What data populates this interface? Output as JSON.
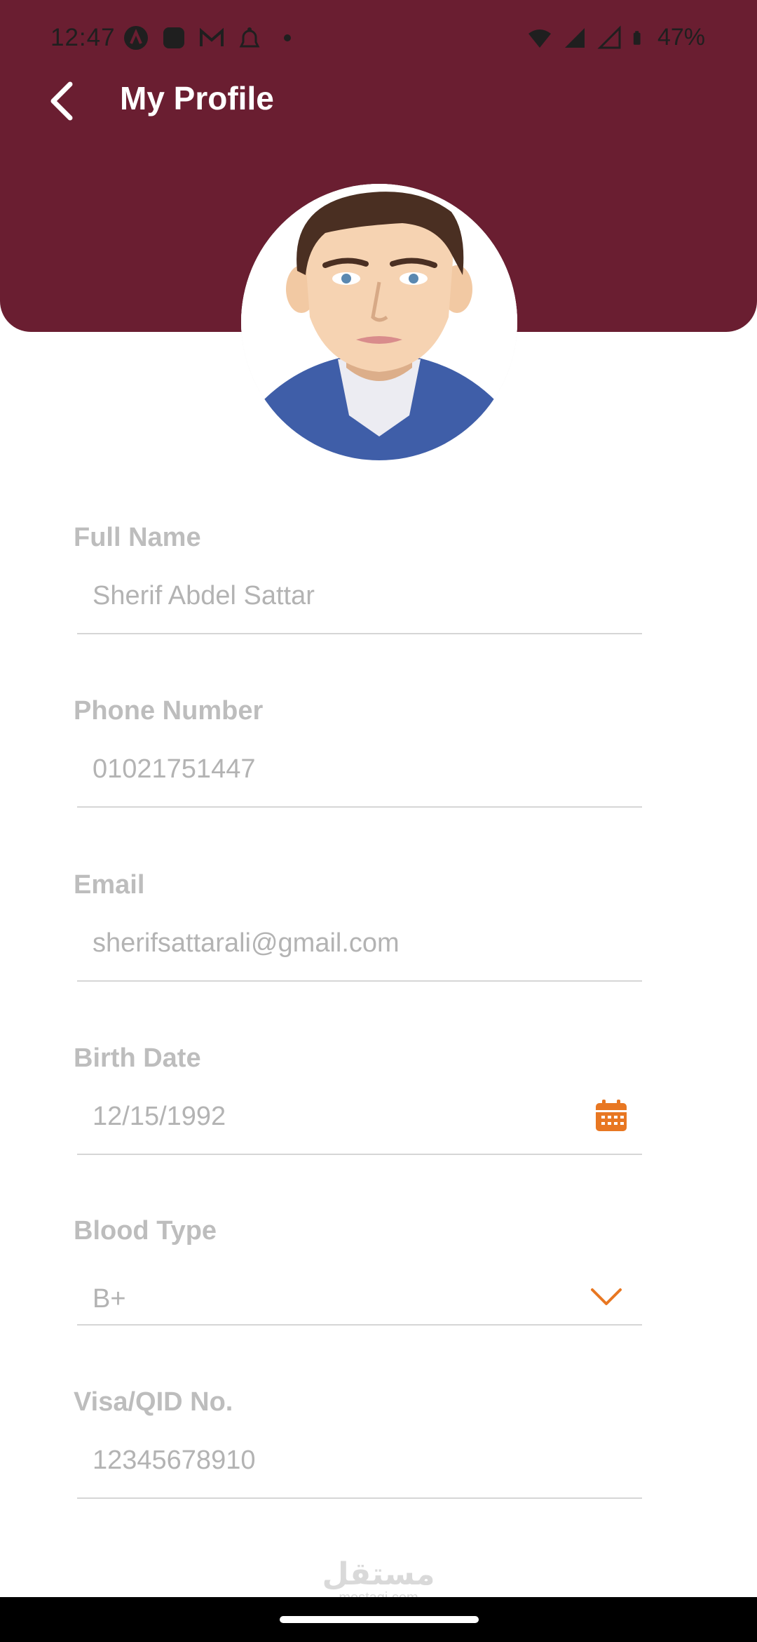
{
  "status_bar": {
    "time": "12:47",
    "battery": "47%"
  },
  "header": {
    "title": "My Profile",
    "background_color": "#6a1e31"
  },
  "fields": {
    "full_name": {
      "label": "Full Name",
      "value": "Sherif Abdel Sattar"
    },
    "phone": {
      "label": "Phone Number",
      "value": "01021751447"
    },
    "email": {
      "label": "Email",
      "value": "sherifsattarali@gmail.com"
    },
    "birth_date": {
      "label": "Birth Date",
      "value": "12/15/1992",
      "icon": "calendar-icon"
    },
    "blood_type": {
      "label": "Blood Type",
      "value": "B+",
      "icon": "chevron-down-icon"
    },
    "visa": {
      "label": "Visa/QID No.",
      "value": "12345678910"
    }
  },
  "accent_color": "#e87722",
  "watermark": {
    "arabic": "مستقل",
    "latin": "mostaqi.com"
  }
}
